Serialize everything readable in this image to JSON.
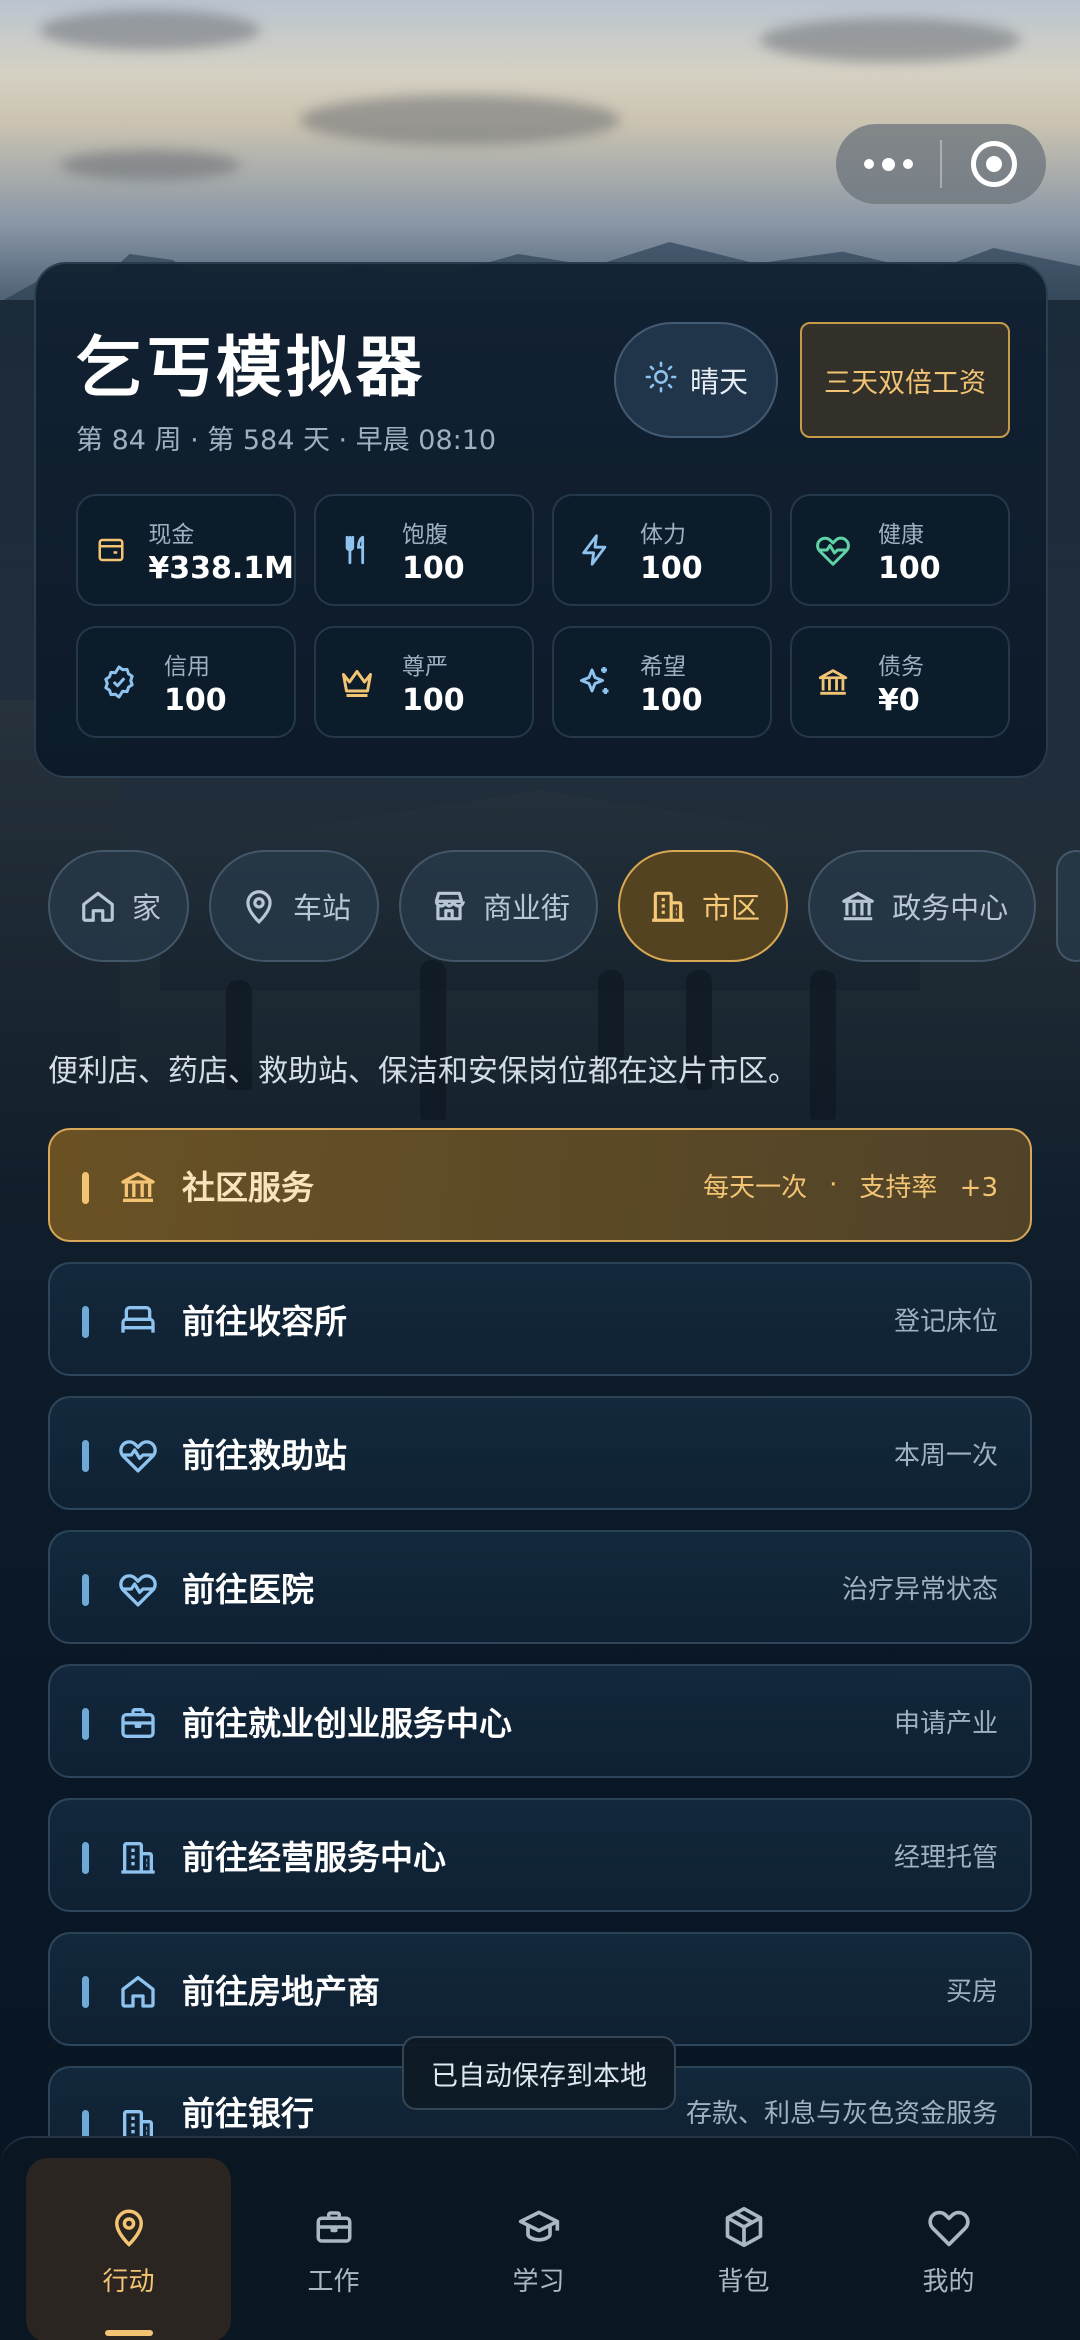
{
  "header": {
    "title": "乞丐模拟器",
    "subtitle": "第 84 周 · 第 584 天 · 早晨 08:10",
    "weather_label": "晴天",
    "bonus_label": "三天双倍工资"
  },
  "stats": [
    {
      "label": "现金",
      "value": "¥338.1M",
      "icon": "wallet-icon"
    },
    {
      "label": "饱腹",
      "value": "100",
      "icon": "utensils-icon"
    },
    {
      "label": "体力",
      "value": "100",
      "icon": "lightning-icon"
    },
    {
      "label": "健康",
      "value": "100",
      "icon": "heart-pulse-icon"
    },
    {
      "label": "信用",
      "value": "100",
      "icon": "badge-check-icon"
    },
    {
      "label": "尊严",
      "value": "100",
      "icon": "crown-icon"
    },
    {
      "label": "希望",
      "value": "100",
      "icon": "sparkles-icon"
    },
    {
      "label": "债务",
      "value": "¥0",
      "icon": "bank-icon"
    }
  ],
  "locations": [
    {
      "label": "家",
      "icon": "home-icon",
      "active": false
    },
    {
      "label": "车站",
      "icon": "map-pin-icon",
      "active": false
    },
    {
      "label": "商业街",
      "icon": "store-icon",
      "active": false
    },
    {
      "label": "市区",
      "icon": "building-icon",
      "active": true
    },
    {
      "label": "政务中心",
      "icon": "government-icon",
      "active": false
    }
  ],
  "location_description": "便利店、药店、救助站、保洁和安保岗位都在这片市区。",
  "actions": [
    {
      "title": "社区服务",
      "meta": "每天一次",
      "meta2": "支持率",
      "meta3": "+3",
      "icon": "government-icon"
    },
    {
      "title": "前往收容所",
      "meta": "登记床位",
      "icon": "bed-icon"
    },
    {
      "title": "前往救助站",
      "meta": "本周一次",
      "icon": "heart-pulse-icon"
    },
    {
      "title": "前往医院",
      "meta": "治疗异常状态",
      "icon": "heart-pulse-icon"
    },
    {
      "title": "前往就业创业服务中心",
      "meta": "申请产业",
      "icon": "briefcase-icon"
    },
    {
      "title": "前往经营服务中心",
      "meta": "经理托管",
      "icon": "building-icon"
    },
    {
      "title": "前往房地产商",
      "meta": "买房",
      "icon": "home-icon"
    },
    {
      "title": "前往银行",
      "meta": "存款、利息与灰色资金服务",
      "icon": "building-icon"
    }
  ],
  "toast": "已自动保存到本地",
  "nav": [
    {
      "label": "行动",
      "icon": "map-pin-icon",
      "active": true
    },
    {
      "label": "工作",
      "icon": "briefcase-icon",
      "active": false
    },
    {
      "label": "学习",
      "icon": "graduation-cap-icon",
      "active": false
    },
    {
      "label": "背包",
      "icon": "package-icon",
      "active": false
    },
    {
      "label": "我的",
      "icon": "heart-icon",
      "active": false
    }
  ],
  "colors": {
    "accent_gold": "#f3c474",
    "icon_blue": "#6ea9d8",
    "card_bg": "#0f1f30"
  }
}
